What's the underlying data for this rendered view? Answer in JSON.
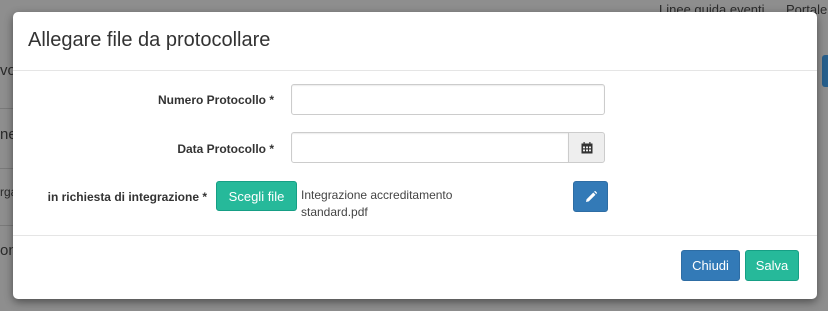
{
  "background": {
    "nav_links": [
      "Linee guida eventi",
      "Portale"
    ],
    "fragments": [
      "vo",
      "ne",
      "rga",
      "oni"
    ]
  },
  "modal": {
    "title": "Allegare file da protocollare",
    "fields": {
      "numero_protocollo": {
        "label": "Numero Protocollo *",
        "value": "",
        "placeholder": ""
      },
      "data_protocollo": {
        "label": "Data Protocollo *",
        "value": "",
        "placeholder": "",
        "icon": "calendar-icon"
      },
      "integrazione": {
        "label": "in richiesta di integrazione *",
        "choose_label": "Scegli file",
        "file_line1": "Integrazione accreditamento",
        "file_line2": "standard.pdf",
        "edit_icon": "pencil-icon"
      }
    },
    "footer": {
      "close_label": "Chiudi",
      "save_label": "Salva"
    }
  },
  "colors": {
    "primary": "#337ab7",
    "success": "#26b99a",
    "overlay": "#8e8e8e"
  }
}
